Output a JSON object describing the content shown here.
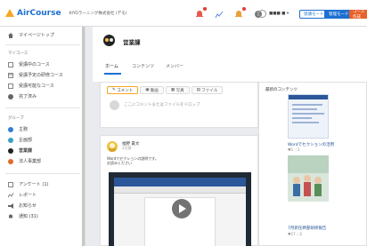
{
  "header": {
    "logo": "AirCourse",
    "org": "KIYOラーニング株式会社 (デモ)",
    "user": "■■■ ■ ▾",
    "btn_outline": "受講モード",
    "btn_solid": "管理モード",
    "btn_orange": "コース作成"
  },
  "sidebar": {
    "top": "マイページトップ",
    "my_course": "マイコース",
    "items": [
      "受講中のコース",
      "受講予定の研修コース",
      "受講可能なコース",
      "完了済み"
    ],
    "group_section": "グループ",
    "groups": [
      "主務",
      "企画部",
      "営業課",
      "法人事業部"
    ],
    "bottom": [
      "アンケート (1)",
      "レポート",
      "お知らせ",
      "通知 (31)"
    ]
  },
  "group": {
    "title": "営業課",
    "tabs": [
      "ホーム",
      "コンテンツ",
      "メンバー"
    ]
  },
  "post_box": {
    "tabs": [
      "コメント",
      "動画",
      "写真",
      "ファイル"
    ],
    "placeholder": "ここにコメントまたはファイルをドロップ"
  },
  "feed": {
    "name": "福野 貴文",
    "sub": "2日前",
    "text1": "Wordでセクションの説明です。",
    "text2": "お読みください"
  },
  "latest": {
    "title": "最新のコンテンツ",
    "cap1": "Wordでセクションの活用",
    "meta1": "♥1 ◌1",
    "cap2": "7月新任幹部研修報告",
    "meta2": "♥17 ◌2"
  },
  "colors": {
    "accent": "#1d6fd1",
    "orange": "#e8622a"
  }
}
